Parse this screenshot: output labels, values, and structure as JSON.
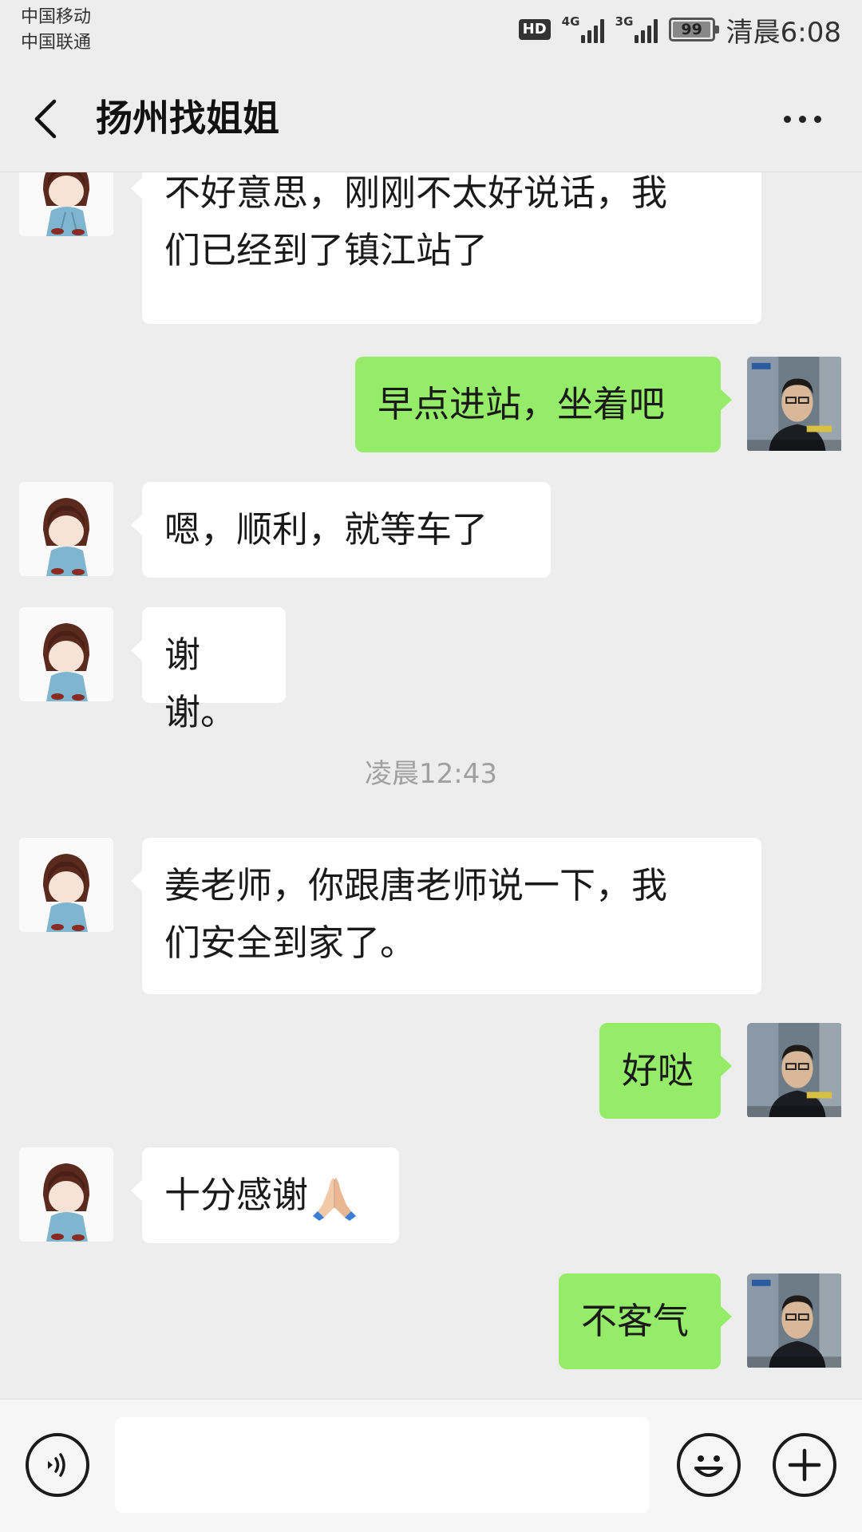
{
  "status_bar": {
    "carrier_1": "中国移动",
    "carrier_2": "中国联通",
    "hd": "HD",
    "network_1": "4G",
    "network_2": "3G",
    "battery": "99",
    "time": "清晨6:08"
  },
  "header": {
    "title": "扬州找姐姐",
    "back_icon": "chevron-left-icon",
    "more_icon": "more-dots-icon"
  },
  "colors": {
    "background": "#ededed",
    "incoming_bubble": "#ffffff",
    "outgoing_bubble": "#95ec69",
    "timestamp": "#a0a0a0"
  },
  "messages": [
    {
      "direction": "in",
      "lines": [
        "不好意思，刚刚不太好说话，我",
        "们已经到了镇江站了"
      ]
    },
    {
      "direction": "out",
      "text": "早点进站，坐着吧"
    },
    {
      "direction": "in",
      "text": "嗯，顺利，就等车了"
    },
    {
      "direction": "in",
      "text": "谢谢。"
    },
    {
      "direction": "in",
      "lines": [
        "姜老师，你跟唐老师说一下，我",
        "们安全到家了。"
      ]
    },
    {
      "direction": "out",
      "text": "好哒"
    },
    {
      "direction": "in",
      "text": "十分感谢",
      "emoji": "folded-hands-icon"
    },
    {
      "direction": "out",
      "text": "不客气"
    }
  ],
  "timestamp": "凌晨12:43",
  "input_bar": {
    "voice_icon": "voice-icon",
    "input_value": "",
    "emoji_icon": "smiley-icon",
    "plus_icon": "plus-icon"
  }
}
